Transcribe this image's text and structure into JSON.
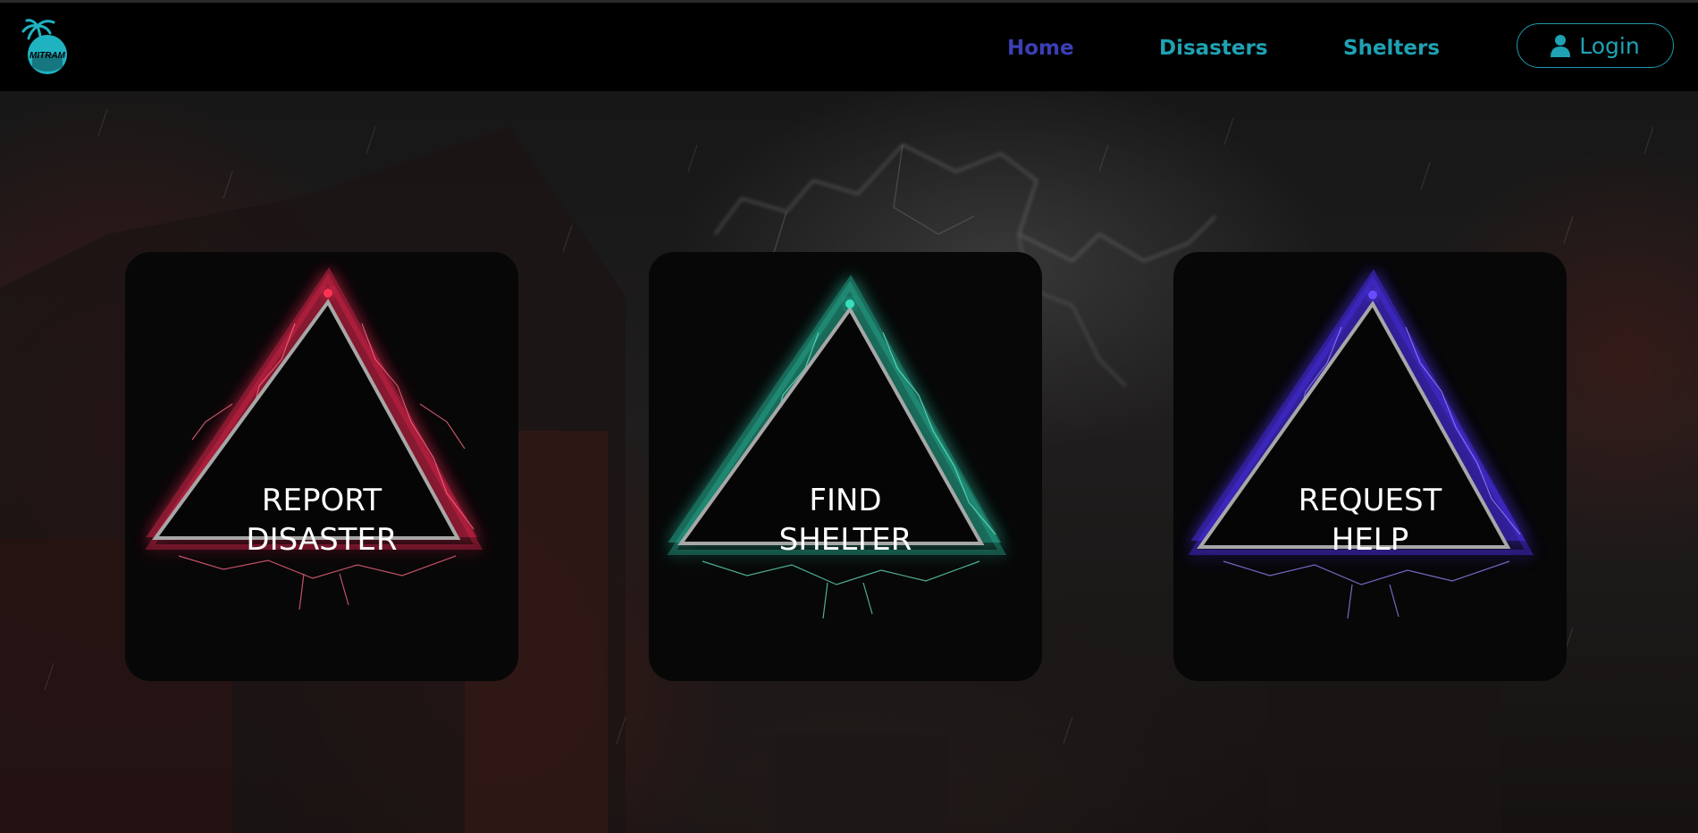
{
  "brand": {
    "logo_text": "MITRAM",
    "logo_icon": "palm-island-logo-icon"
  },
  "nav": {
    "links": [
      {
        "label": "Home",
        "active": true
      },
      {
        "label": "Disasters",
        "active": false
      },
      {
        "label": "Shelters",
        "active": false
      }
    ],
    "login": {
      "label": "Login",
      "icon": "user-icon"
    }
  },
  "cards": [
    {
      "line1": "REPORT",
      "line2": "DISASTER",
      "color": "#e0264e",
      "glow": "#ff3355"
    },
    {
      "line1": "FIND",
      "line2": "SHELTER",
      "color": "#2bbfa0",
      "glow": "#39e0bb"
    },
    {
      "line1": "REQUEST",
      "line2": "HELP",
      "color": "#4a2ee8",
      "glow": "#6a4cff"
    }
  ],
  "colors": {
    "accent": "#1fa2b4",
    "active": "#3b3fb5",
    "card_bg": "#070707"
  }
}
